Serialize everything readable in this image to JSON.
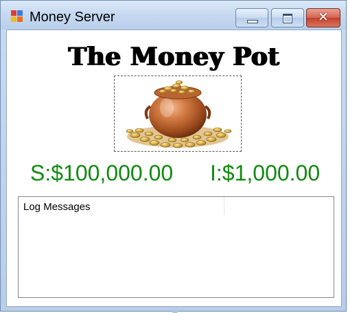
{
  "window": {
    "title": "Money Server",
    "app_icon": "windows-forms-app-icon",
    "controls": {
      "minimize_icon": "minimize-icon",
      "maximize_icon": "maximize-icon",
      "close_label": "✕"
    }
  },
  "main": {
    "heading": "The Money Pot",
    "picture": {
      "icon": "pot-of-gold-coins-image"
    },
    "savings_balance": "S:$100,000.00",
    "income_balance": "I:$1,000.00",
    "balance_color": "#118a11",
    "log": {
      "columns": [
        "Log Messages"
      ],
      "rows": []
    }
  }
}
